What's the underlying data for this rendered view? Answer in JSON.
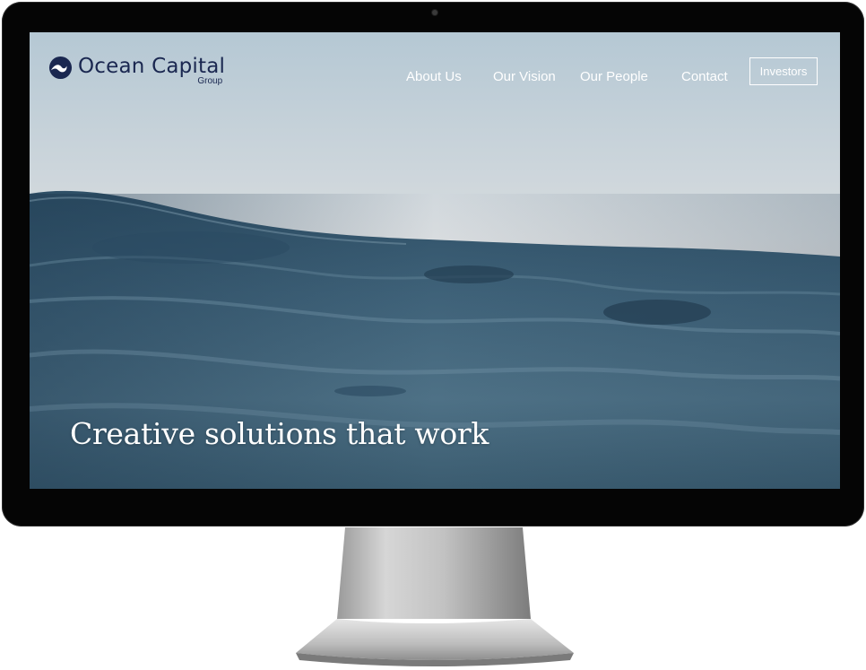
{
  "brand": {
    "name": "Ocean Capital",
    "sub": "Group",
    "color": "#1a2750"
  },
  "nav": {
    "items": [
      {
        "label": "About Us"
      },
      {
        "label": "Our Vision"
      },
      {
        "label": "Our People"
      },
      {
        "label": "Contact"
      }
    ],
    "cta_label": "Investors"
  },
  "hero": {
    "headline": "Creative solutions that work",
    "background": "ocean-waves-at-dusk"
  },
  "colors": {
    "sky_top": "#b8cbd6",
    "sky_horizon": "#ecd9cf",
    "sea": "#2b4e64",
    "text": "#ffffff"
  }
}
